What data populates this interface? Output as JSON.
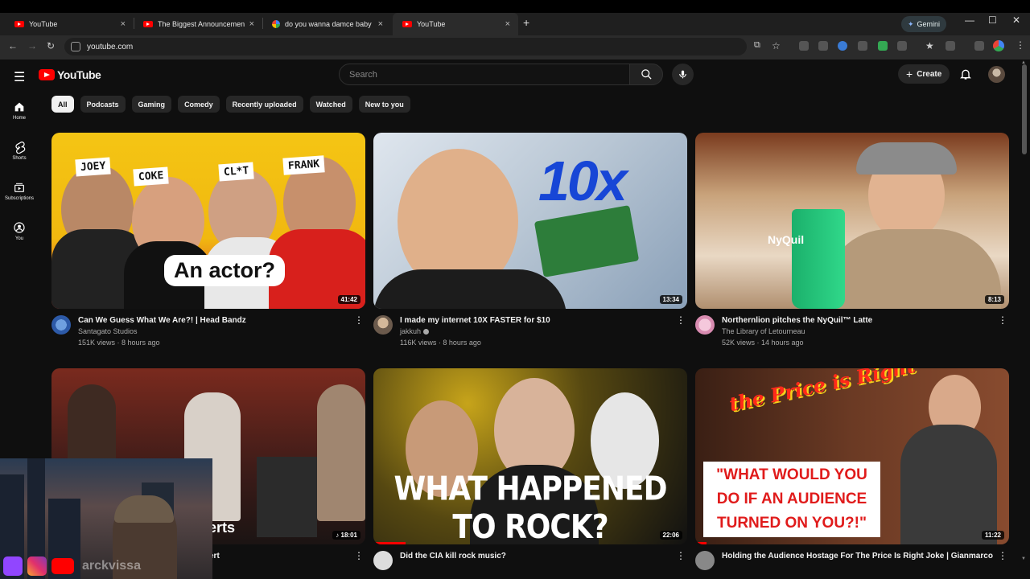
{
  "browser": {
    "tabs": [
      {
        "title": "YouTube",
        "icon": "youtube-favicon",
        "active": false
      },
      {
        "title": "The Biggest Announcement of",
        "icon": "youtube-favicon",
        "active": false
      },
      {
        "title": "do you wanna damce baby",
        "icon": "google-favicon",
        "active": false
      },
      {
        "title": "YouTube",
        "icon": "youtube-favicon",
        "active": true
      }
    ],
    "new_tab_label": "+",
    "gemini_label": "Gemini",
    "address": "youtube.com"
  },
  "youtube": {
    "logo_text": "YouTube",
    "search_placeholder": "Search",
    "create_label": "Create",
    "sidebar": [
      {
        "label": "Home",
        "icon": "home-icon"
      },
      {
        "label": "Shorts",
        "icon": "shorts-icon"
      },
      {
        "label": "Subscriptions",
        "icon": "subscriptions-icon"
      },
      {
        "label": "You",
        "icon": "you-icon"
      }
    ],
    "chips": [
      "All",
      "Podcasts",
      "Gaming",
      "Comedy",
      "Recently uploaded",
      "Watched",
      "New to you"
    ],
    "videos": [
      {
        "title": "Can We Guess What We Are?! | Head Bandz",
        "channel": "Santagato Studios",
        "stats": "151K views · 8 hours ago",
        "duration": "41:42",
        "thumb_text": [
          "JOEY",
          "COKE",
          "CL*T",
          "FRANK",
          "An actor?"
        ]
      },
      {
        "title": "I made my internet 10X FASTER for $10",
        "channel": "jakkuh",
        "stats": "116K views · 8 hours ago",
        "duration": "13:34",
        "thumb_text": [
          "10x"
        ]
      },
      {
        "title": "Northernlion pitches the NyQuil™ Latte",
        "channel": "The Library of Letourneau",
        "stats": "52K views · 14 hours ago",
        "duration": "8:13",
        "thumb_text": [
          "NyQuil"
        ]
      },
      {
        "title": "",
        "channel": "",
        "stats": "",
        "duration": "18:01",
        "thumb_text": [
          "erts"
        ]
      },
      {
        "title": "Did the CIA kill rock music?",
        "channel": "",
        "stats": "",
        "duration": "22:06",
        "thumb_text": [
          "WHAT HAPPENED TO ROCK?"
        ]
      },
      {
        "title": "Holding the Audience Hostage For The Price Is Right Joke | Gianmarco",
        "channel": "",
        "stats": "",
        "duration": "11:22",
        "thumb_text": [
          "the Price is Right",
          "\"WHAT WOULD YOU DO IF AN AUDIENCE TURNED ON YOU?!\""
        ]
      }
    ],
    "partial_title_fragment": "ert"
  },
  "overlay": {
    "handle": "arckvissa"
  },
  "colors": {
    "brand_red": "#ff0000",
    "background": "#0f0f0f",
    "chip_bg": "#272727",
    "chip_active_bg": "#f1f1f1"
  }
}
